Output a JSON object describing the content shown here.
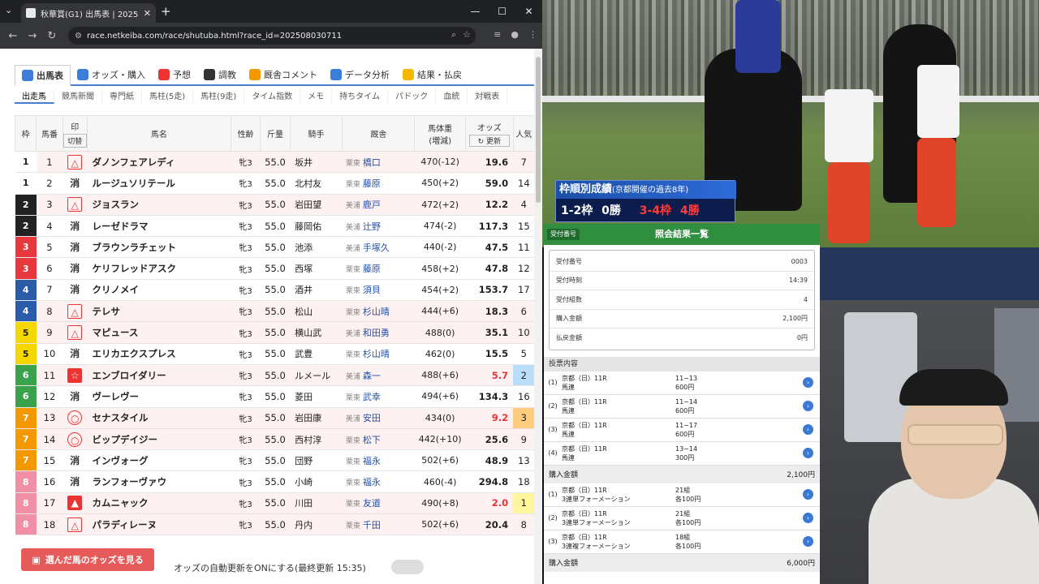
{
  "browser": {
    "tab_title": "秋華賞(G1) 出馬表 | 2025年10月",
    "url": "race.netkeiba.com/race/shutuba.html?race_id=202508030711"
  },
  "nav": {
    "main_tabs": [
      "出馬表",
      "オッズ・購入",
      "予想",
      "調教",
      "厩舎コメント",
      "データ分析",
      "結果・払戻"
    ],
    "sub_tabs": [
      "出走馬",
      "競馬新聞",
      "専門紙",
      "馬柱(5走)",
      "馬柱(9走)",
      "タイム指数",
      "メモ",
      "持ちタイム",
      "パドック",
      "血統",
      "対戦表"
    ]
  },
  "table": {
    "headers": {
      "waku": "枠",
      "umaban": "馬番",
      "mark": "印",
      "mark_sub": "切替",
      "name": "馬名",
      "sex_age": "性齢",
      "kinryo": "斤量",
      "jockey": "騎手",
      "trainer": "厩舎",
      "weight": "馬体重",
      "weight_sub": "(増減)",
      "odds": "オッズ",
      "odds_sub": "更新",
      "pop": "人気"
    },
    "rows": [
      {
        "waku": "1",
        "umaban": "1",
        "mark": "△",
        "name": "ダノンフェアレディ",
        "sex": "牝3",
        "kin": "55.0",
        "jockey": "坂井",
        "region": "栗東",
        "trainer": "橋口",
        "weight": "470(-12)",
        "odds": "19.6",
        "pop": "7"
      },
      {
        "waku": "1",
        "umaban": "2",
        "mark": "消",
        "name": "ルージュソリテール",
        "sex": "牝3",
        "kin": "55.0",
        "jockey": "北村友",
        "region": "栗東",
        "trainer": "藤原",
        "weight": "450(+2)",
        "odds": "59.0",
        "pop": "14"
      },
      {
        "waku": "2",
        "umaban": "3",
        "mark": "△",
        "name": "ジョスラン",
        "sex": "牝3",
        "kin": "55.0",
        "jockey": "岩田望",
        "region": "美浦",
        "trainer": "鹿戸",
        "weight": "472(+2)",
        "odds": "12.2",
        "pop": "4"
      },
      {
        "waku": "2",
        "umaban": "4",
        "mark": "消",
        "name": "レーゼドラマ",
        "sex": "牝3",
        "kin": "55.0",
        "jockey": "藤岡佑",
        "region": "美浦",
        "trainer": "辻野",
        "weight": "474(-2)",
        "odds": "117.3",
        "pop": "15"
      },
      {
        "waku": "3",
        "umaban": "5",
        "mark": "消",
        "name": "ブラウンラチェット",
        "sex": "牝3",
        "kin": "55.0",
        "jockey": "池添",
        "region": "美浦",
        "trainer": "手塚久",
        "weight": "440(-2)",
        "odds": "47.5",
        "pop": "11"
      },
      {
        "waku": "3",
        "umaban": "6",
        "mark": "消",
        "name": "ケリフレッドアスク",
        "sex": "牝3",
        "kin": "55.0",
        "jockey": "西塚",
        "region": "栗東",
        "trainer": "藤原",
        "weight": "458(+2)",
        "odds": "47.8",
        "pop": "12"
      },
      {
        "waku": "4",
        "umaban": "7",
        "mark": "消",
        "name": "クリノメイ",
        "sex": "牝3",
        "kin": "55.0",
        "jockey": "酒井",
        "region": "栗東",
        "trainer": "須貝",
        "weight": "454(+2)",
        "odds": "153.7",
        "pop": "17"
      },
      {
        "waku": "4",
        "umaban": "8",
        "mark": "△",
        "name": "テレサ",
        "sex": "牝3",
        "kin": "55.0",
        "jockey": "松山",
        "region": "栗東",
        "trainer": "杉山晴",
        "weight": "444(+6)",
        "odds": "18.3",
        "pop": "6"
      },
      {
        "waku": "5",
        "umaban": "9",
        "mark": "△",
        "name": "マピュース",
        "sex": "牝3",
        "kin": "55.0",
        "jockey": "横山武",
        "region": "美浦",
        "trainer": "和田勇",
        "weight": "488(0)",
        "odds": "35.1",
        "pop": "10"
      },
      {
        "waku": "5",
        "umaban": "10",
        "mark": "消",
        "name": "エリカエクスプレス",
        "sex": "牝3",
        "kin": "55.0",
        "jockey": "武豊",
        "region": "栗東",
        "trainer": "杉山晴",
        "weight": "462(0)",
        "odds": "15.5",
        "pop": "5"
      },
      {
        "waku": "6",
        "umaban": "11",
        "mark": "☆",
        "name": "エンブロイダリー",
        "sex": "牝3",
        "kin": "55.0",
        "jockey": "ルメール",
        "region": "美浦",
        "trainer": "森一",
        "weight": "488(+6)",
        "odds": "5.7",
        "pop": "2"
      },
      {
        "waku": "6",
        "umaban": "12",
        "mark": "消",
        "name": "ヴーレヴー",
        "sex": "牝3",
        "kin": "55.0",
        "jockey": "菱田",
        "region": "栗東",
        "trainer": "武幸",
        "weight": "494(+6)",
        "odds": "134.3",
        "pop": "16"
      },
      {
        "waku": "7",
        "umaban": "13",
        "mark": "○",
        "name": "セナスタイル",
        "sex": "牝3",
        "kin": "55.0",
        "jockey": "岩田康",
        "region": "美浦",
        "trainer": "安田",
        "weight": "434(0)",
        "odds": "9.2",
        "pop": "3"
      },
      {
        "waku": "7",
        "umaban": "14",
        "mark": "○",
        "name": "ビップデイジー",
        "sex": "牝3",
        "kin": "55.0",
        "jockey": "西村淳",
        "region": "栗東",
        "trainer": "松下",
        "weight": "442(+10)",
        "odds": "25.6",
        "pop": "9"
      },
      {
        "waku": "7",
        "umaban": "15",
        "mark": "消",
        "name": "インヴォーグ",
        "sex": "牝3",
        "kin": "55.0",
        "jockey": "団野",
        "region": "栗東",
        "trainer": "福永",
        "weight": "502(+6)",
        "odds": "48.9",
        "pop": "13"
      },
      {
        "waku": "8",
        "umaban": "16",
        "mark": "消",
        "name": "ランフォーヴァウ",
        "sex": "牝3",
        "kin": "55.0",
        "jockey": "小崎",
        "region": "栗東",
        "trainer": "福永",
        "weight": "460(-4)",
        "odds": "294.8",
        "pop": "18"
      },
      {
        "waku": "8",
        "umaban": "17",
        "mark": "▲",
        "name": "カムニャック",
        "sex": "牝3",
        "kin": "55.0",
        "jockey": "川田",
        "region": "栗東",
        "trainer": "友道",
        "weight": "490(+8)",
        "odds": "2.0",
        "pop": "1"
      },
      {
        "waku": "8",
        "umaban": "18",
        "mark": "△",
        "name": "パラディレーヌ",
        "sex": "牝3",
        "kin": "55.0",
        "jockey": "丹内",
        "region": "栗東",
        "trainer": "千田",
        "weight": "502(+6)",
        "odds": "20.4",
        "pop": "8"
      }
    ]
  },
  "bottom": {
    "watch_button": "選んだ馬のオッズを見る",
    "auto_update": "オッズの自動更新をONにする(最終更新 15:35)"
  },
  "video": {
    "banner_title": "枠順別成績",
    "banner_sub": "(京都開催の過去8年)",
    "banner_left": "1-2枠",
    "banner_left_val": "0勝",
    "banner_right": "3-4枠",
    "banner_right_val": "4勝"
  },
  "ipat": {
    "tag": "受付番号",
    "title": "照会結果一覧",
    "summary": [
      {
        "label": "受付番号",
        "value": "0003"
      },
      {
        "label": "受付時刻",
        "value": "14:39"
      },
      {
        "label": "受付組数",
        "value": "4"
      },
      {
        "label": "購入金額",
        "value": "2,100円"
      },
      {
        "label": "払戻金額",
        "value": "0円"
      }
    ],
    "section": "投票内容",
    "bets": [
      {
        "n": "(1)",
        "race": "京都（日）11R",
        "type": "馬連",
        "combo": "11−13",
        "amount": "600円"
      },
      {
        "n": "(2)",
        "race": "京都（日）11R",
        "type": "馬連",
        "combo": "11−14",
        "amount": "600円"
      },
      {
        "n": "(3)",
        "race": "京都（日）11R",
        "type": "馬連",
        "combo": "11−17",
        "amount": "600円"
      },
      {
        "n": "(4)",
        "race": "京都（日）11R",
        "type": "馬連",
        "combo": "13−14",
        "amount": "300円"
      }
    ],
    "total1_label": "購入金額",
    "total1_value": "2,100円",
    "bets2": [
      {
        "n": "(1)",
        "race": "京都（日）11R",
        "type": "3連単フォーメーション",
        "combo": "21組",
        "amount": "各100円"
      },
      {
        "n": "(2)",
        "race": "京都（日）11R",
        "type": "3連単フォーメーション",
        "combo": "21組",
        "amount": "各100円"
      },
      {
        "n": "(3)",
        "race": "京都（日）11R",
        "type": "3連複フォーメーション",
        "combo": "18組",
        "amount": "各100円"
      }
    ],
    "total2_label": "購入金額",
    "total2_value": "6,000円"
  },
  "colors": {
    "waku": {
      "1": "#ffffff",
      "2": "#222222",
      "3": "#e8383d",
      "4": "#2a5caa",
      "5": "#f5d800",
      "6": "#3aa24a",
      "7": "#f39800",
      "8": "#f08fa6"
    },
    "accent": "#4a7cd1",
    "ipat_green": "#2f8f3e"
  }
}
